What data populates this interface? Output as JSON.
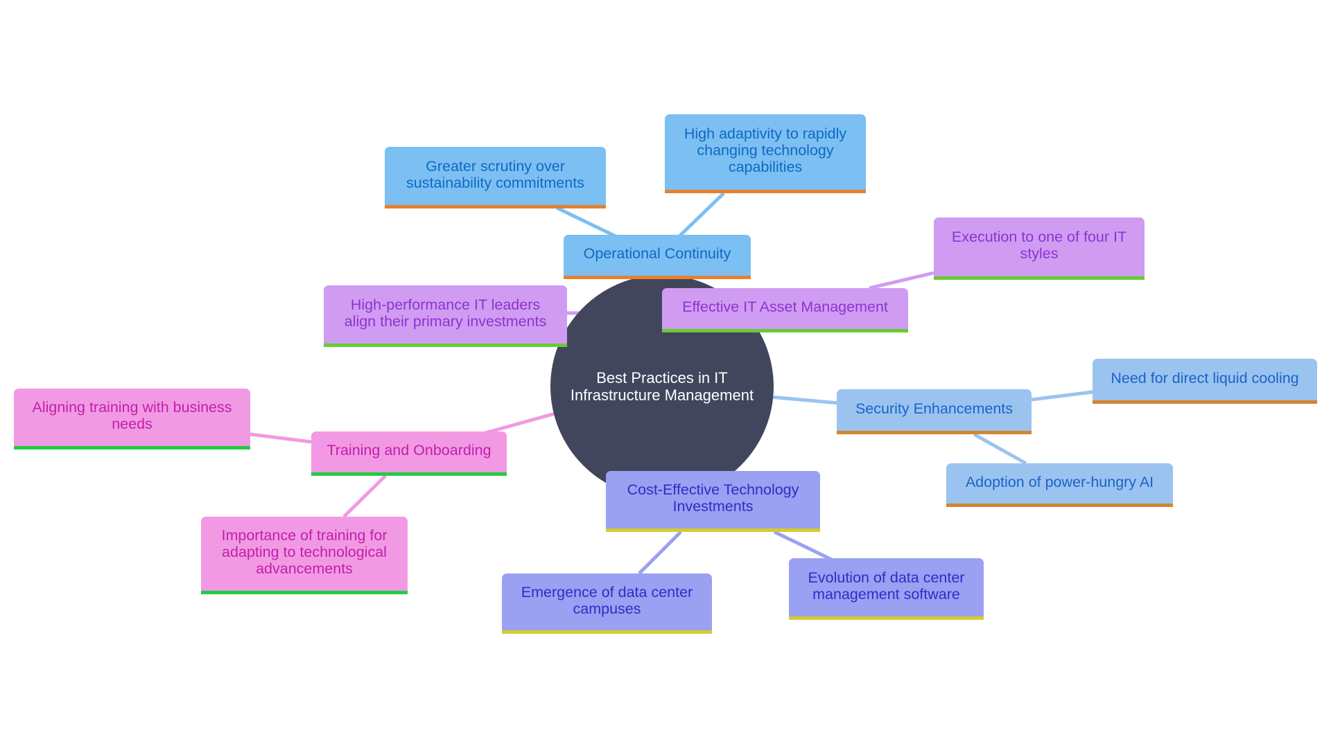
{
  "diagram": {
    "type": "mind-map",
    "root": {
      "label": "Best Practices in IT Infrastructure Management",
      "color": "#41465c",
      "text_color": "#ffffff"
    },
    "branches": [
      {
        "label": "Operational Continuity",
        "palette": {
          "fill": "#7cbff2",
          "text": "#0e69c3",
          "underline": "#e7802f",
          "edge": "#7cbff2"
        },
        "children": [
          {
            "label": "Greater scrutiny over sustainability commitments"
          },
          {
            "label": "High adaptivity to rapidly changing technology capabilities"
          }
        ]
      },
      {
        "label": "Effective IT Asset Management",
        "palette": {
          "fill": "#cf9cf2",
          "text": "#8c33d0",
          "underline": "#66cc33",
          "edge": "#cf9cf2"
        },
        "children": [
          {
            "label": "Execution to one of four IT styles"
          },
          {
            "label": "High-performance IT leaders align their primary investments"
          }
        ]
      },
      {
        "label": "Security Enhancements",
        "palette": {
          "fill": "#9ac3f0",
          "text": "#1b63c6",
          "underline": "#d4852f",
          "edge": "#9ac3f0"
        },
        "children": [
          {
            "label": "Need for direct liquid cooling"
          },
          {
            "label": "Adoption of power-hungry AI"
          }
        ]
      },
      {
        "label": "Cost-Effective Technology Investments",
        "palette": {
          "fill": "#9aa0f2",
          "text": "#2b2fc4",
          "underline": "#d4cc2e",
          "edge": "#9aa0f2"
        },
        "children": [
          {
            "label": "Emergence of data center campuses"
          },
          {
            "label": "Evolution of data center management software"
          }
        ]
      },
      {
        "label": "Training and Onboarding",
        "palette": {
          "fill": "#f299e3",
          "text": "#c020ab",
          "underline": "#22cc44",
          "edge": "#f299e3"
        },
        "children": [
          {
            "label": "Aligning training with business needs"
          },
          {
            "label": "Importance of training for adapting to technological advancements"
          }
        ]
      }
    ]
  }
}
